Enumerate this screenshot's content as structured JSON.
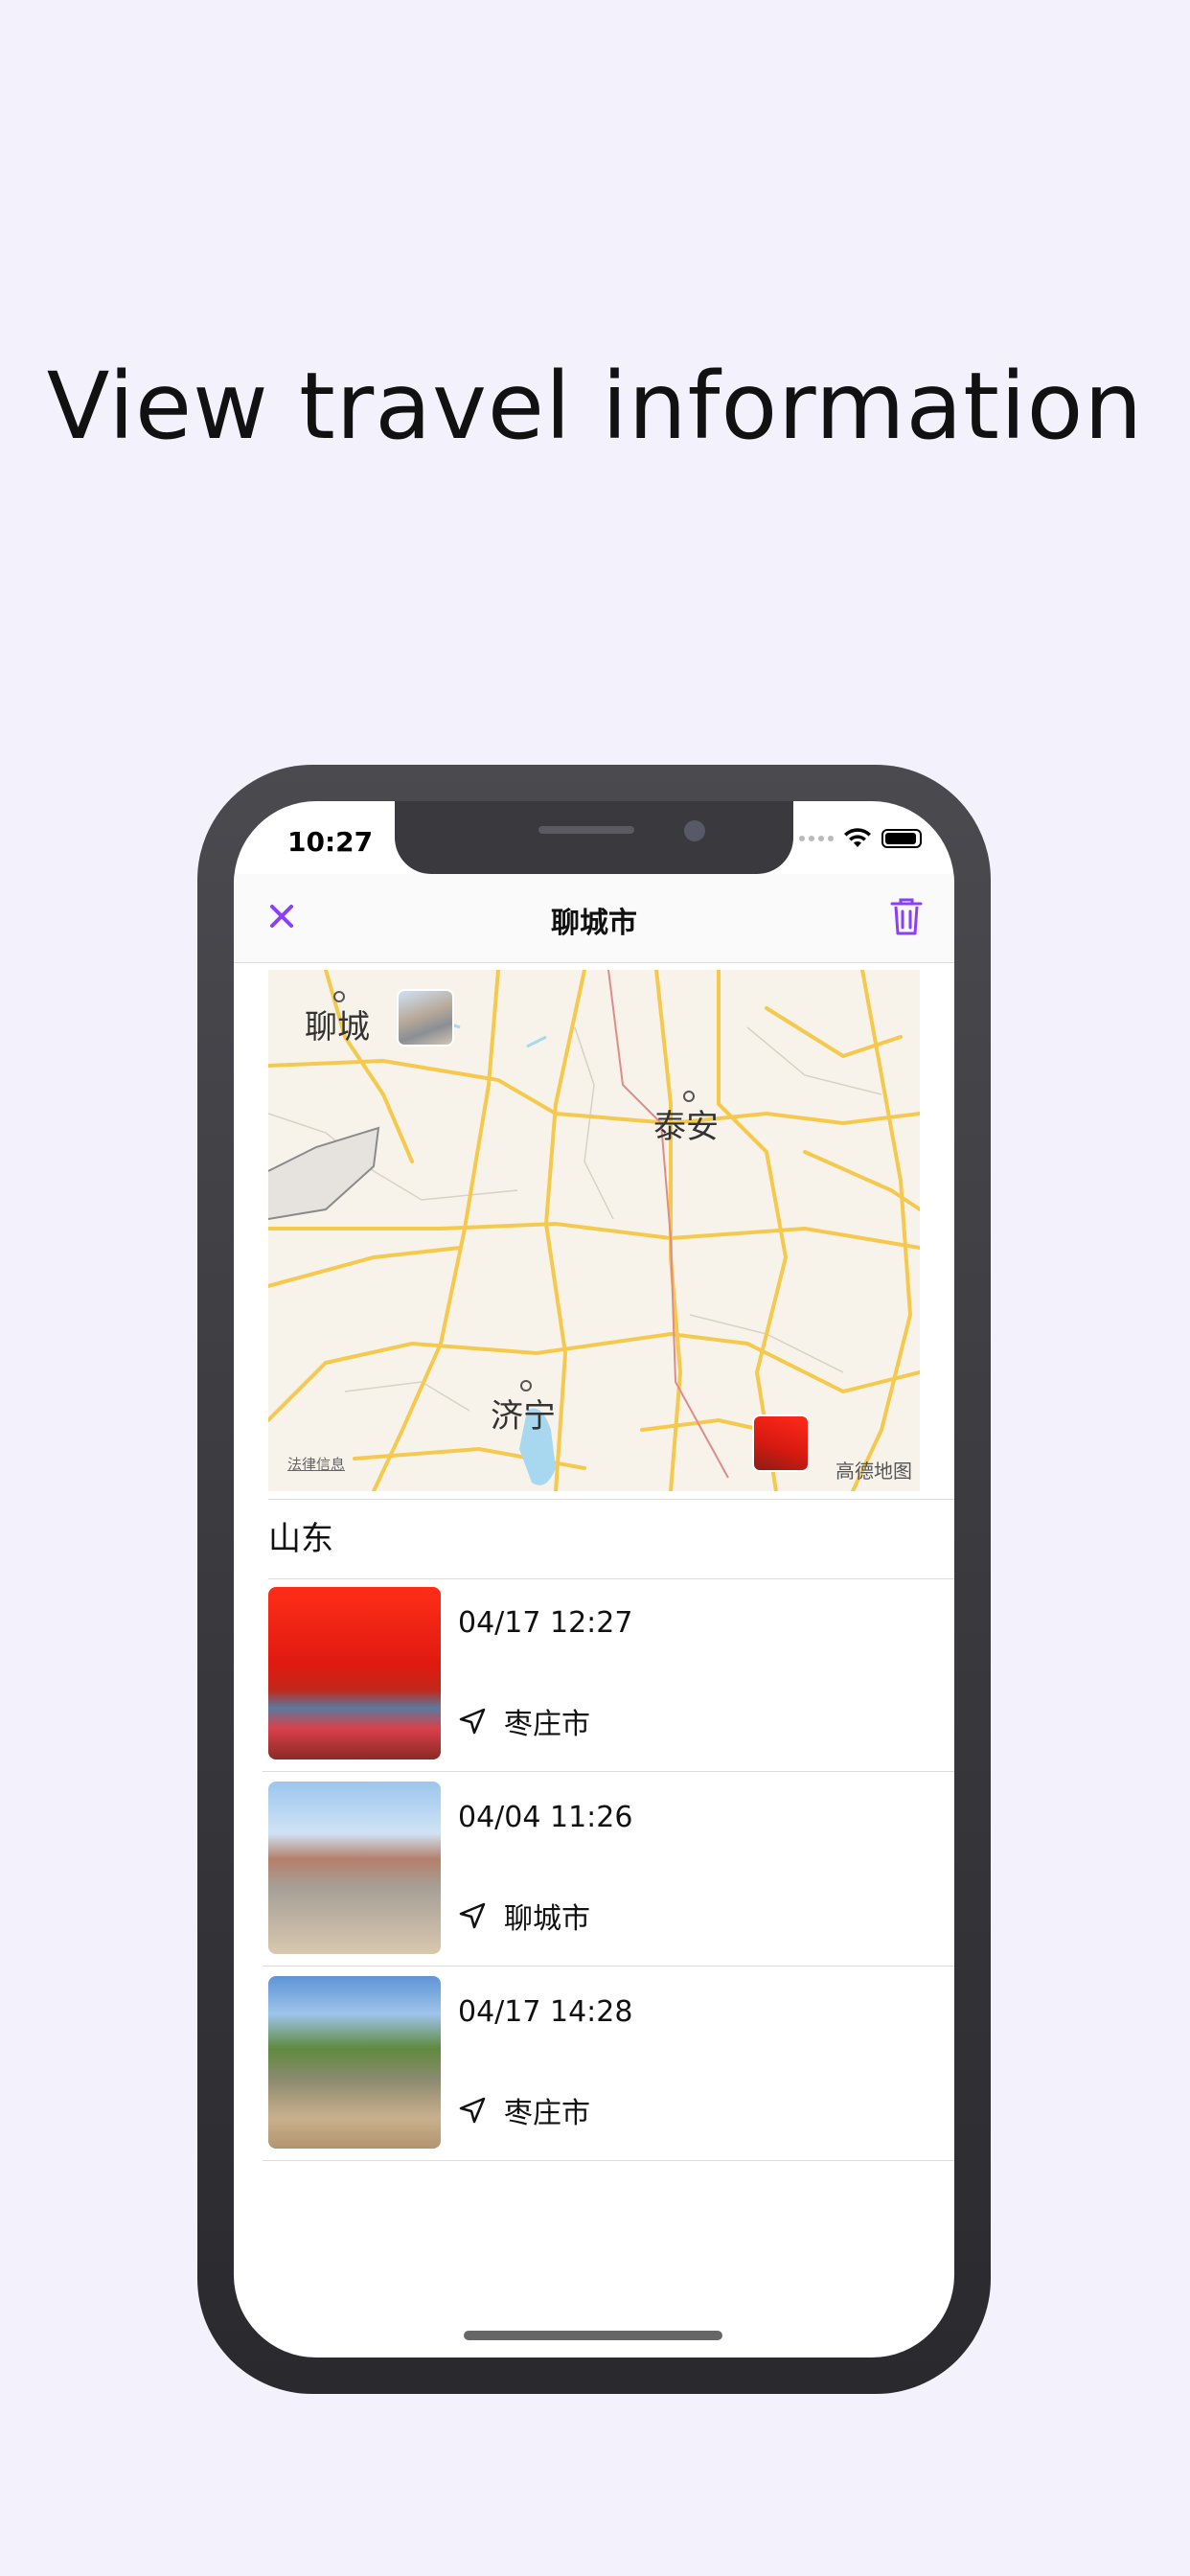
{
  "headline": "View travel information",
  "status": {
    "time": "10:27"
  },
  "nav": {
    "title": "聊城市"
  },
  "map": {
    "labels": {
      "city1": "聊城",
      "city2": "泰安",
      "city3": "济宁"
    },
    "legal": "法律信息",
    "provider": "高德地图"
  },
  "section": {
    "title": "山东"
  },
  "entries": [
    {
      "date": "04/17 12:27",
      "location": "枣庄市"
    },
    {
      "date": "04/04 11:26",
      "location": "聊城市"
    },
    {
      "date": "04/17 14:28",
      "location": "枣庄市"
    }
  ],
  "colors": {
    "accent": "#8a3ffc",
    "background": "#f3f2fc",
    "road": "#f5c84e"
  },
  "icons": [
    "close-icon",
    "trash-icon",
    "wifi-icon",
    "battery-icon",
    "location-arrow-icon"
  ]
}
